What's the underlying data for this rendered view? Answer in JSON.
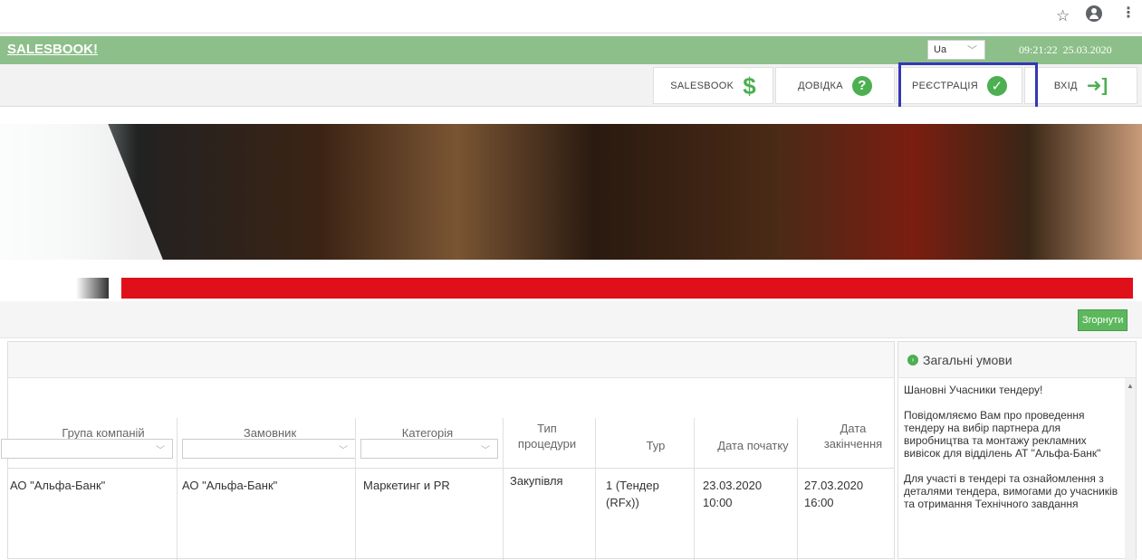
{
  "browser": {
    "star_icon": "star-icon",
    "account_icon": "account-icon",
    "menu_icon": "kebab-menu-icon"
  },
  "header": {
    "brand": "SALESBOOK!",
    "language": "Ua",
    "time": "09:21:22",
    "date": "25.03.2020"
  },
  "nav": {
    "salesbook": "SALESBOOK",
    "help": "ДОВІДКА",
    "register": "РЕЄСТРАЦІЯ",
    "login": "ВХІД"
  },
  "toolbar": {
    "collapse_label": "Згорнути"
  },
  "table": {
    "columns": [
      "Група компаній",
      "Замовник",
      "Категорія",
      "Тип процедури",
      "Тур",
      "Дата початку",
      "Дата закінчення"
    ],
    "rows": [
      {
        "group": "АО \"Альфа-Банк\"",
        "customer": "АО \"Альфа-Банк\"",
        "category": "Маркетинг и PR",
        "procedure": "Закупівля",
        "round": "1 (Тендер (RFx))",
        "start": "23.03.2020 10:00",
        "end": "27.03.2020 16:00"
      }
    ]
  },
  "side": {
    "title": "Загальні умови",
    "paragraphs": [
      "Шановні Учасники тендеру!",
      "Повідомляємо Вам про проведення тендеру на вибір партнера для виробництва та монтажу рекламних вивісок для відділень АТ \"Альфа-Банк\"",
      "Для участі в тендері та ознайомлення з деталями тендера, вимогами до учасників та отримання Технічного завдання"
    ]
  },
  "colors": {
    "header_green": "#8dbf8a",
    "accent_green": "#4caf50",
    "highlight_blue": "#3338b5",
    "banner_red": "#e0101a"
  }
}
